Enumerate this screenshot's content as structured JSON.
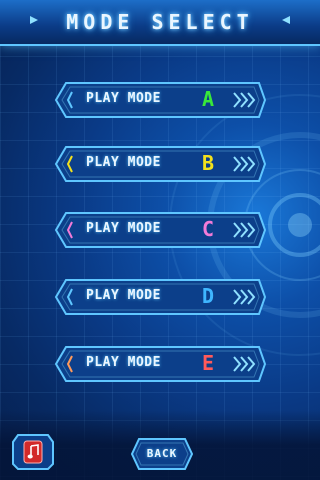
{
  "screen": {
    "title": "MODE SELECT"
  },
  "modes": [
    {
      "label": "PLAY MODE",
      "letter": "A",
      "letter_color": "#39e83a"
    },
    {
      "label": "PLAY MODE",
      "letter": "B",
      "letter_color": "#f2e11d"
    },
    {
      "label": "PLAY MODE",
      "letter": "C",
      "letter_color": "#f27bd8"
    },
    {
      "label": "PLAY MODE",
      "letter": "D",
      "letter_color": "#3fb6ff"
    },
    {
      "label": "PLAY MODE",
      "letter": "E",
      "letter_color": "#ff5a5a"
    }
  ],
  "footer": {
    "back_label": "BACK",
    "sound_icon": "music-note-icon"
  },
  "colors": {
    "accent": "#5fc6ff",
    "button_fill": "#0c3f8a",
    "sound_button_fill": "#d22a2a"
  }
}
